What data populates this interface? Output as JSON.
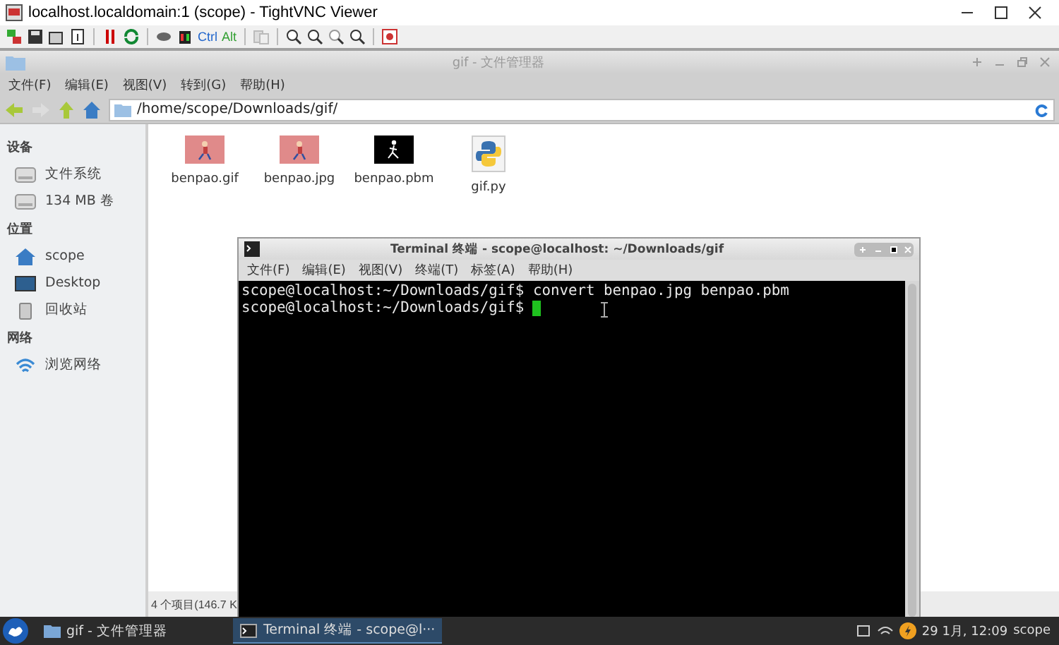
{
  "viewer": {
    "title": "localhost.localdomain:1 (scope) - TightVNC Viewer",
    "key_buttons": [
      "Ctrl",
      "Alt"
    ]
  },
  "file_manager": {
    "title": "gif - 文件管理器",
    "menu": [
      "文件(F)",
      "编辑(E)",
      "视图(V)",
      "转到(G)",
      "帮助(H)"
    ],
    "path": "/home/scope/Downloads/gif/",
    "sidebar": [
      {
        "heading": "设备",
        "items": [
          {
            "label": "文件系统",
            "kind": "drive"
          },
          {
            "label": "134 MB 卷",
            "kind": "drive"
          }
        ]
      },
      {
        "heading": "位置",
        "items": [
          {
            "label": "scope",
            "kind": "home"
          },
          {
            "label": "Desktop",
            "kind": "desktop"
          },
          {
            "label": "回收站",
            "kind": "trash"
          }
        ]
      },
      {
        "heading": "网络",
        "items": [
          {
            "label": "浏览网络",
            "kind": "network"
          }
        ]
      }
    ],
    "files": [
      {
        "name": "benpao.gif"
      },
      {
        "name": "benpao.jpg"
      },
      {
        "name": "benpao.pbm",
        "kind": "bitmap"
      },
      {
        "name": "gif.py",
        "kind": "python"
      }
    ],
    "status": "4 个项目(146.7 K"
  },
  "terminal": {
    "title": "Terminal 终端 - scope@localhost: ~/Downloads/gif",
    "menu": [
      "文件(F)",
      "编辑(E)",
      "视图(V)",
      "终端(T)",
      "标签(A)",
      "帮助(H)"
    ],
    "lines": [
      {
        "prompt": "scope@localhost:~/Downloads/gif$",
        "command": "convert benpao.jpg benpao.pbm",
        "cursor": false
      },
      {
        "prompt": "scope@localhost:~/Downloads/gif$",
        "cursor": true
      }
    ]
  },
  "taskbar": {
    "tasks": [
      {
        "label": "gif - 文件管理器",
        "kind": "folder",
        "selected": false
      },
      {
        "label": "Terminal 终端 - scope@l···",
        "kind": "terminal",
        "selected": true
      }
    ],
    "clock": "29 1月, 12:09",
    "user": "scope"
  }
}
